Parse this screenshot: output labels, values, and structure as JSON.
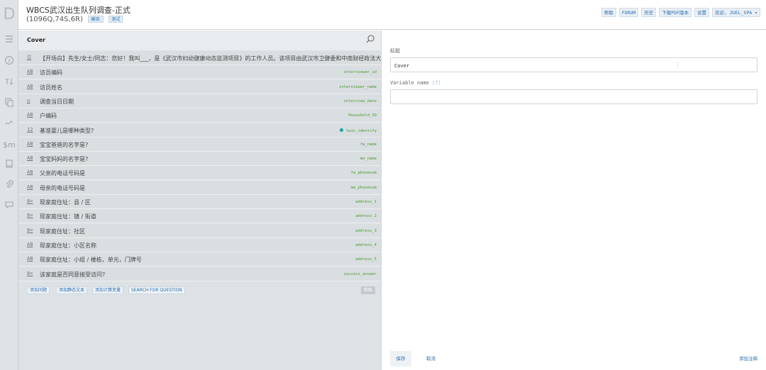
{
  "header": {
    "title": "WBCS武汉出生队列调查-正式",
    "subtitle": "(1096Q,74S,6R)",
    "badges": [
      "编译:",
      "测试"
    ],
    "nav": [
      "帮助",
      "FORUM",
      "历史",
      "下载PDF版本",
      "设置",
      "欢迎, ZUEL_SPA ▾"
    ]
  },
  "rail": {
    "logo": "D",
    "icons": [
      "menu-icon",
      "info-icon",
      "questions-icon",
      "copy-icon",
      "routing-icon",
      "macro-icon",
      "book-icon",
      "attachment-icon",
      "comment-icon"
    ]
  },
  "panel": {
    "title": "Cover",
    "questions": [
      {
        "type": "☰",
        "label": "【开场白】先生/女士/同志：您好！我叫___，是《武汉市妇幼健康动态监测项目》的工作人员。该项目由武汉市卫健委和中南财经政法大学联合实施",
        "var": "",
        "dot": false
      },
      {
        "type": "AB",
        "label": "访员编码",
        "var": "interviewer_id",
        "dot": false
      },
      {
        "type": "AB",
        "label": "访员姓名",
        "var": "interviewer_name",
        "dot": false
      },
      {
        "type": "◷",
        "label": "调查当日日期",
        "var": "interview_date",
        "dot": false
      },
      {
        "type": "AB",
        "label": "户编码",
        "var": "Household_ID",
        "dot": false
      },
      {
        "type": "12",
        "label": "基准婴儿是哪种类型?",
        "var": "twin_identify",
        "dot": true
      },
      {
        "type": "AB",
        "label": "宝宝爸爸的名字是?",
        "var": "fa_name",
        "dot": false
      },
      {
        "type": "AB",
        "label": "宝宝妈妈的名字是?",
        "var": "ma_name",
        "dot": false
      },
      {
        "type": "AB",
        "label": "父亲的电话号码是",
        "var": "fa_phonenum",
        "dot": false
      },
      {
        "type": "AB",
        "label": "母亲的电话号码是",
        "var": "ma_phonenum",
        "dot": false
      },
      {
        "type": "8=",
        "label": "现家庭住址：县 / 区",
        "var": "address_1",
        "dot": false
      },
      {
        "type": "8=",
        "label": "现家庭住址：镇 / 街道",
        "var": "address_2",
        "dot": false
      },
      {
        "type": "8=",
        "label": "现家庭住址：社区",
        "var": "address_3",
        "dot": false
      },
      {
        "type": "AB",
        "label": "现家庭住址：小区名称",
        "var": "address_4",
        "dot": false
      },
      {
        "type": "AB",
        "label": "现家庭住址：小组 / 楼栋，单元，门牌号",
        "var": "address_5",
        "dot": false
      },
      {
        "type": "8=",
        "label": "该家庭是否同意接受访问?",
        "var": "success_answer",
        "dot": false
      }
    ],
    "footer_buttons": [
      "添加问题",
      "添加静态文本",
      "添加计算变量",
      "SEARCH FOR QUESTION"
    ],
    "paste": "粘贴"
  },
  "editor": {
    "title_label": "标题",
    "title_value": "Cover",
    "varname_label": "Variable name",
    "varname_count": "(7)",
    "varname_value": "",
    "save": "保存",
    "cancel": "取消",
    "add_note": "添加注释"
  },
  "colors": {
    "accent": "#2a6fb0",
    "variable": "#4c9a2a",
    "dot": "#1aa3a3"
  }
}
